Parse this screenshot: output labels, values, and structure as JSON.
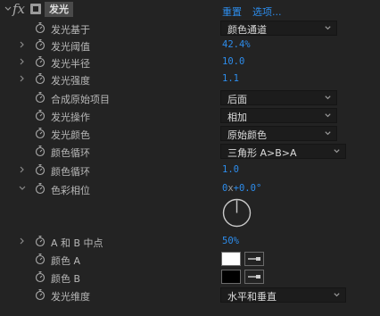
{
  "header": {
    "fx_label": "fx",
    "effect_name": "发光",
    "reset_label": "重置",
    "options_label": "选项..."
  },
  "icons": {
    "twisty": "chevron-right-icon",
    "twisty_open": "chevron-down-icon",
    "stopwatch": "stopwatch-icon",
    "dropdown": "chevron-down-icon",
    "eyedropper": "eyedropper-icon"
  },
  "colors": {
    "accent_blue": "#2d8ceb",
    "color_a": "#ffffff",
    "color_b": "#000000"
  },
  "properties": {
    "glow_based_on": {
      "label": "发光基于",
      "value": "颜色通道"
    },
    "glow_threshold": {
      "label": "发光阈值",
      "value": "42.4%"
    },
    "glow_radius": {
      "label": "发光半径",
      "value": "10.0"
    },
    "glow_intensity": {
      "label": "发光强度",
      "value": "1.1"
    },
    "composite_original": {
      "label": "合成原始项目",
      "value": "后面"
    },
    "glow_operation": {
      "label": "发光操作",
      "value": "相加"
    },
    "glow_colors": {
      "label": "发光颜色",
      "value": "原始颜色"
    },
    "color_looping": {
      "label": "颜色循环",
      "value": "三角形 A>B>A"
    },
    "color_loops": {
      "label": "颜色循环",
      "value": "1.0"
    },
    "color_phase": {
      "label": "色彩相位",
      "revolutions": "0",
      "unit": "x",
      "degrees": "+0.0°"
    },
    "ab_midpoint": {
      "label": "A 和 B 中点",
      "value": "50%"
    },
    "color_a": {
      "label": "颜色 A"
    },
    "color_b": {
      "label": "颜色 B"
    },
    "glow_dimensions": {
      "label": "发光维度",
      "value": "水平和垂直"
    }
  }
}
